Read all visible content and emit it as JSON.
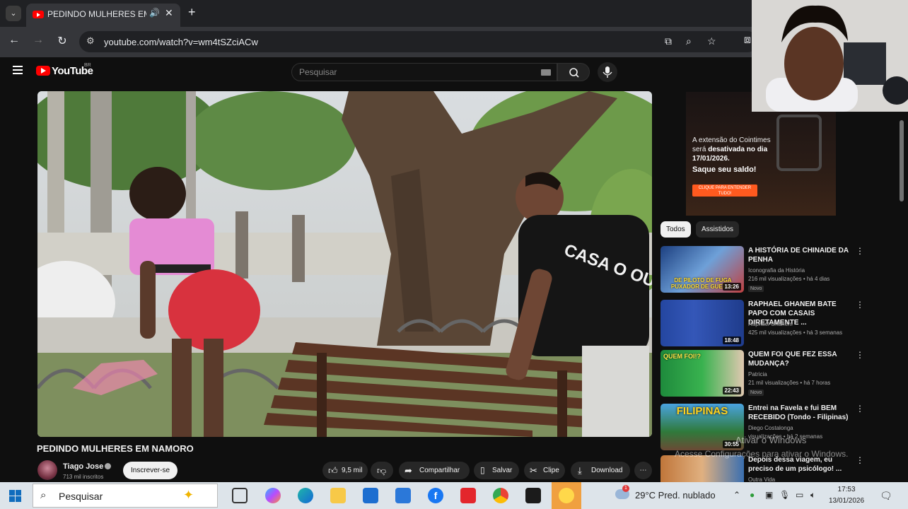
{
  "browser": {
    "tab_title": "PEDINDO MULHERES EM NAMORO",
    "url": "youtube.com/watch?v=wm4tSZciACw"
  },
  "yt": {
    "logo": "YouTube",
    "country": "BR",
    "search_placeholder": "Pesquisar"
  },
  "video": {
    "title": "PEDINDO MULHERES EM NAMORO",
    "channel": "Tiago Jose",
    "subscribers": "713 mil inscritos",
    "subscribe_label": "Inscrever-se",
    "likes": "9,5 mil",
    "share_label": "Compartilhar",
    "save_label": "Salvar",
    "clip_label": "Clipe",
    "download_label": "Download",
    "shirt_text": "CASA O OU"
  },
  "ad": {
    "line1": "A extensão do Cointimes",
    "line2_pre": "será ",
    "line2_bold": "desativada no dia",
    "line3": "17/01/2026.",
    "line4": "Saque seu saldo!",
    "cta": "CLIQUE PARA ENTENDER TUDO!"
  },
  "chips": [
    "Todos",
    "Assistidos"
  ],
  "recommendations": [
    {
      "title": "A HISTÓRIA DE CHINAIDE DA PENHA",
      "channel": "Iconografia da História",
      "meta": "216 mil visualizações • há 4 dias",
      "duration": "13:26",
      "badge": "Novo",
      "thumb_text": "DE PILOTO DE FUGA PUXADOR DE GUERRA"
    },
    {
      "title": "RAPHAEL GHANEM BATE PAPO COM CASAIS DIRETAMENTE ...",
      "channel": "Raphael Ghanem",
      "meta": "425 mil visualizações • há 3 semanas",
      "duration": "18:48",
      "badge": "",
      "thumb_text": ""
    },
    {
      "title": "QUEM FOI QUE FEZ ESSA MUDANÇA?",
      "channel": "Patricia",
      "meta": "21 mil visualizações • há 7 horas",
      "duration": "22:43",
      "badge": "Novo",
      "thumb_text": "QUEM FOI!?"
    },
    {
      "title": "Entrei na Favela e fui BEM RECEBIDO (Tondo - Filipinas)",
      "channel": "Diego Costalonga",
      "meta": "visualizações • há 2 semanas",
      "duration": "30:55",
      "badge": "",
      "thumb_text": "FILIPINAS"
    },
    {
      "title": "Depois dessa viagem, eu preciso de um psicólogo! ...",
      "channel": "Outra Vida",
      "meta": "",
      "duration": "",
      "badge": "",
      "thumb_text": ""
    }
  ],
  "watermark": {
    "line1": "Ativar o Windows",
    "line2": "Acesse Configurações para ativar o Windows."
  },
  "taskbar": {
    "search": "Pesquisar",
    "weather": "29°C  Pred. nublado",
    "time": "17:53",
    "date": "13/01/2026",
    "notif_count": "1"
  }
}
